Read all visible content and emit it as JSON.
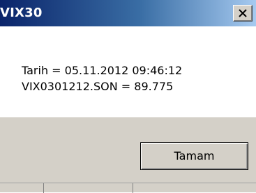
{
  "window": {
    "title": "VIX30",
    "close_label": "×"
  },
  "message": {
    "line1": "Tarih = 05.11.2012 09:46:12",
    "line2": "VIX0301212.SON = 89.775"
  },
  "buttons": {
    "ok_label": "Tamam"
  },
  "colors": {
    "title_bar_start": "#0a246a",
    "title_bar_end": "#a6caf0",
    "button_face": "#d4d0c8",
    "background": "#ffffff"
  },
  "icons": {
    "close": "close-icon"
  }
}
